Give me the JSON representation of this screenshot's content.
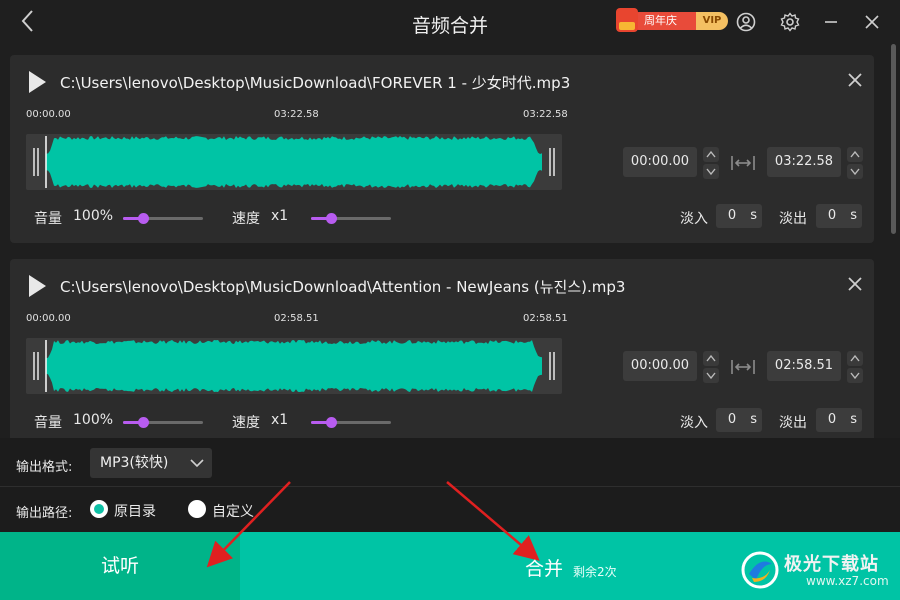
{
  "window": {
    "title": "音频合并",
    "promo_text": "周年庆",
    "promo_vip": "VIP"
  },
  "tracks": [
    {
      "path": "C:\\Users\\lenovo\\Desktop\\MusicDownload\\FOREVER 1 - 少女时代.mp3",
      "time_start": "00:00.00",
      "time_mid": "03:22.58",
      "time_end": "03:22.58",
      "range_start": "00:00.00",
      "range_end": "03:22.58",
      "volume_label": "音量",
      "volume_value": "100%",
      "volume_level": 0.25,
      "speed_label": "速度",
      "speed_value": "x1",
      "speed_level": 0.25,
      "fade_in_label": "淡入",
      "fade_in_value": "0",
      "fade_out_label": "淡出",
      "fade_out_value": "0",
      "unit": "s"
    },
    {
      "path": "C:\\Users\\lenovo\\Desktop\\MusicDownload\\Attention - NewJeans (뉴진스).mp3",
      "time_start": "00:00.00",
      "time_mid": "02:58.51",
      "time_end": "02:58.51",
      "range_start": "00:00.00",
      "range_end": "02:58.51",
      "volume_label": "音量",
      "volume_value": "100%",
      "volume_level": 0.25,
      "speed_label": "速度",
      "speed_value": "x1",
      "speed_level": 0.25,
      "fade_in_label": "淡入",
      "fade_in_value": "0",
      "fade_out_label": "淡出",
      "fade_out_value": "0",
      "unit": "s"
    }
  ],
  "settings": {
    "format_label": "输出格式:",
    "format_value": "MP3(较快)",
    "path_label": "输出路径:",
    "path_option_original": "原目录",
    "path_option_custom": "自定义",
    "path_selected": "原目录"
  },
  "actions": {
    "preview": "试听",
    "merge": "合并",
    "remaining": "剩余2次"
  },
  "watermark": {
    "name": "极光下载站",
    "url": "www.xz7.com"
  },
  "colors": {
    "waveform": "#00c4a5",
    "accent": "#00c4a5",
    "slider": "#b85cf0",
    "annotation_arrow": "#e02020"
  }
}
